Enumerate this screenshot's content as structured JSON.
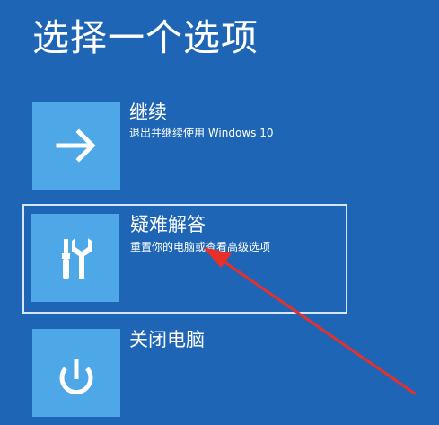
{
  "page": {
    "title": "选择一个选项"
  },
  "options": [
    {
      "title": "继续",
      "description": "退出并继续使用 Windows 10",
      "icon": "arrow-right-icon"
    },
    {
      "title": "疑难解答",
      "description": "重置你的电脑或查看高级选项",
      "icon": "tools-icon",
      "selected": true
    },
    {
      "title": "关闭电脑",
      "description": "",
      "icon": "power-icon"
    }
  ],
  "annotation": {
    "icon": "red-arrow-icon",
    "color": "#e8302a"
  },
  "colors": {
    "background": "#1e66b5",
    "tile": "#4ea7e6",
    "text": "#ffffff"
  }
}
